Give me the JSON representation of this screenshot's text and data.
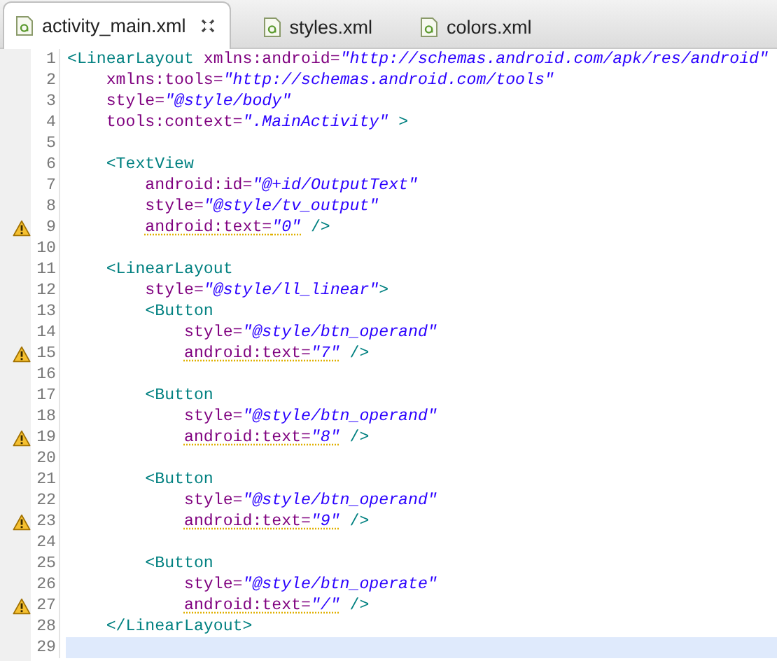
{
  "tabs": [
    {
      "label": "activity_main.xml",
      "selected": true,
      "closable": true
    },
    {
      "label": "styles.xml",
      "selected": false,
      "closable": false
    },
    {
      "label": "colors.xml",
      "selected": false,
      "closable": false
    }
  ],
  "editor": {
    "lines": [
      {
        "number": "1",
        "warning": false,
        "current": false,
        "tokens": [
          {
            "kind": "tag",
            "text": "<LinearLayout"
          },
          {
            "kind": "attr",
            "text": " xmlns:android="
          },
          {
            "kind": "value",
            "text": "\"http://schemas.android.com/apk/res/android\""
          }
        ]
      },
      {
        "number": "2",
        "warning": false,
        "current": false,
        "tokens": [
          {
            "kind": "attr",
            "text": "    xmlns:tools="
          },
          {
            "kind": "value",
            "text": "\"http://schemas.android.com/tools\""
          }
        ]
      },
      {
        "number": "3",
        "warning": false,
        "current": false,
        "tokens": [
          {
            "kind": "attr",
            "text": "    style="
          },
          {
            "kind": "value",
            "text": "\"@style/body\""
          }
        ]
      },
      {
        "number": "4",
        "warning": false,
        "current": false,
        "tokens": [
          {
            "kind": "attr",
            "text": "    tools:context="
          },
          {
            "kind": "value",
            "text": "\".MainActivity\""
          },
          {
            "kind": "tag",
            "text": " >"
          }
        ]
      },
      {
        "number": "5",
        "warning": false,
        "current": false
      },
      {
        "number": "6",
        "warning": false,
        "current": false,
        "tokens": [
          {
            "kind": "tag",
            "text": "    <TextView"
          }
        ]
      },
      {
        "number": "7",
        "warning": false,
        "current": false,
        "tokens": [
          {
            "kind": "attr",
            "text": "        android:id="
          },
          {
            "kind": "value",
            "text": "\"@+id/OutputText\""
          }
        ]
      },
      {
        "number": "8",
        "warning": false,
        "current": false,
        "tokens": [
          {
            "kind": "attr",
            "text": "        style="
          },
          {
            "kind": "value",
            "text": "\"@style/tv_output\""
          }
        ]
      },
      {
        "number": "9",
        "warning": true,
        "current": false,
        "tokens": [
          {
            "kind": "attr",
            "text": "        android:text="
          },
          {
            "kind": "value",
            "text": "\"0\""
          },
          {
            "kind": "tag",
            "text": " />"
          }
        ]
      },
      {
        "number": "10",
        "warning": false,
        "current": false
      },
      {
        "number": "11",
        "warning": false,
        "current": false,
        "tokens": [
          {
            "kind": "tag",
            "text": "    <LinearLayout"
          }
        ]
      },
      {
        "number": "12",
        "warning": false,
        "current": false,
        "tokens": [
          {
            "kind": "attr",
            "text": "        style="
          },
          {
            "kind": "value",
            "text": "\"@style/ll_linear\""
          },
          {
            "kind": "tag",
            "text": ">"
          }
        ]
      },
      {
        "number": "13",
        "warning": false,
        "current": false,
        "tokens": [
          {
            "kind": "tag",
            "text": "        <Button"
          }
        ]
      },
      {
        "number": "14",
        "warning": false,
        "current": false,
        "tokens": [
          {
            "kind": "attr",
            "text": "            style="
          },
          {
            "kind": "value",
            "text": "\"@style/btn_operand\""
          }
        ]
      },
      {
        "number": "15",
        "warning": true,
        "current": false,
        "tokens": [
          {
            "kind": "attr",
            "text": "            android:text="
          },
          {
            "kind": "value",
            "text": "\"7\""
          },
          {
            "kind": "tag",
            "text": " />"
          }
        ]
      },
      {
        "number": "16",
        "warning": false,
        "current": false
      },
      {
        "number": "17",
        "warning": false,
        "current": false,
        "tokens": [
          {
            "kind": "tag",
            "text": "        <Button"
          }
        ]
      },
      {
        "number": "18",
        "warning": false,
        "current": false,
        "tokens": [
          {
            "kind": "attr",
            "text": "            style="
          },
          {
            "kind": "value",
            "text": "\"@style/btn_operand\""
          }
        ]
      },
      {
        "number": "19",
        "warning": true,
        "current": false,
        "tokens": [
          {
            "kind": "attr",
            "text": "            android:text="
          },
          {
            "kind": "value",
            "text": "\"8\""
          },
          {
            "kind": "tag",
            "text": " />"
          }
        ]
      },
      {
        "number": "20",
        "warning": false,
        "current": false
      },
      {
        "number": "21",
        "warning": false,
        "current": false,
        "tokens": [
          {
            "kind": "tag",
            "text": "        <Button"
          }
        ]
      },
      {
        "number": "22",
        "warning": false,
        "current": false,
        "tokens": [
          {
            "kind": "attr",
            "text": "            style="
          },
          {
            "kind": "value",
            "text": "\"@style/btn_operand\""
          }
        ]
      },
      {
        "number": "23",
        "warning": true,
        "current": false,
        "tokens": [
          {
            "kind": "attr",
            "text": "            android:text="
          },
          {
            "kind": "value",
            "text": "\"9\""
          },
          {
            "kind": "tag",
            "text": " />"
          }
        ]
      },
      {
        "number": "24",
        "warning": false,
        "current": false
      },
      {
        "number": "25",
        "warning": false,
        "current": false,
        "tokens": [
          {
            "kind": "tag",
            "text": "        <Button"
          }
        ]
      },
      {
        "number": "26",
        "warning": false,
        "current": false,
        "tokens": [
          {
            "kind": "attr",
            "text": "            style="
          },
          {
            "kind": "value",
            "text": "\"@style/btn_operate\""
          }
        ]
      },
      {
        "number": "27",
        "warning": true,
        "current": false,
        "tokens": [
          {
            "kind": "attr",
            "text": "            android:text="
          },
          {
            "kind": "value",
            "text": "\"/\""
          },
          {
            "kind": "tag",
            "text": " />"
          }
        ]
      },
      {
        "number": "28",
        "warning": false,
        "current": false,
        "tokens": [
          {
            "kind": "tag",
            "text": "    </LinearLayout>"
          }
        ]
      },
      {
        "number": "29",
        "warning": false,
        "current": true
      }
    ]
  }
}
